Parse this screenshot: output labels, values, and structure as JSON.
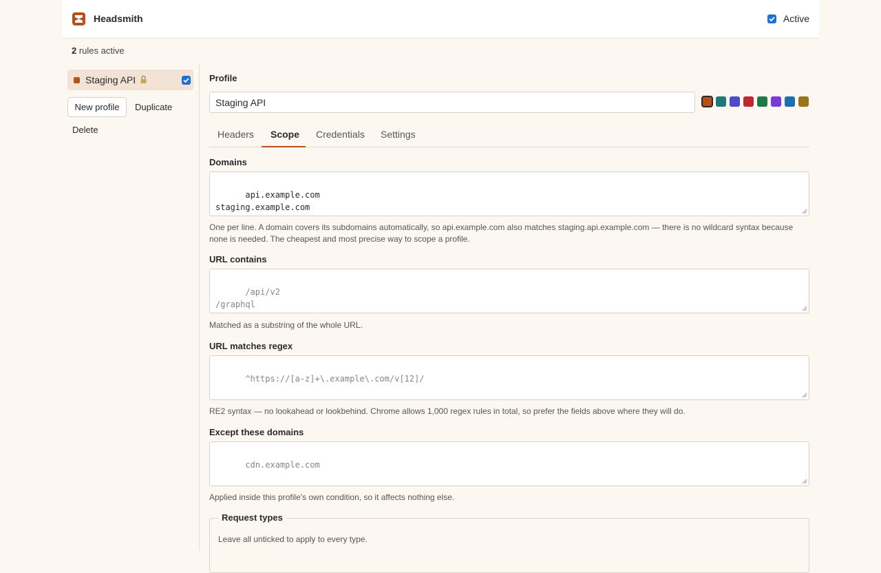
{
  "app": {
    "title": "Headsmith",
    "active_label": "Active",
    "active_checked": true
  },
  "status": {
    "rules_count": "2",
    "rules_suffix": " rules active"
  },
  "sidebar": {
    "profiles": [
      {
        "name": "Staging API",
        "color": "#b8501c",
        "locked": true,
        "enabled": true
      }
    ],
    "new_profile_label": "New profile",
    "duplicate_label": "Duplicate",
    "delete_label": "Delete"
  },
  "profile": {
    "section_label": "Profile",
    "name_value": "Staging API",
    "swatches": [
      "#b8501c",
      "#1e7a76",
      "#4a4cc8",
      "#c0282e",
      "#1c7a4a",
      "#7b3ad6",
      "#1a6fae",
      "#9a7418"
    ],
    "selected_swatch": 0
  },
  "tabs": [
    "Headers",
    "Scope",
    "Credentials",
    "Settings"
  ],
  "active_tab": "Scope",
  "scope": {
    "domains": {
      "label": "Domains",
      "value": "api.example.com\nstaging.example.com",
      "help_line1": "One per line. A domain covers its subdomains automatically, so api.example.com also matches staging.api.example.com — there is no wildcard syntax because",
      "help_line2": "none is needed. The cheapest and most precise way to scope a profile."
    },
    "url_contains": {
      "label": "URL contains",
      "placeholder": "/api/v2\n/graphql",
      "help": "Matched as a substring of the whole URL."
    },
    "url_regex": {
      "label": "URL matches regex",
      "placeholder": "^https://[a-z]+\\.example\\.com/v[12]/",
      "help": "RE2 syntax — no lookahead or lookbehind. Chrome allows 1,000 regex rules in total, so prefer the fields above where they will do."
    },
    "except_domains": {
      "label": "Except these domains",
      "placeholder": "cdn.example.com",
      "help": "Applied inside this profile's own condition, so it affects nothing else."
    },
    "request_types": {
      "legend": "Request types",
      "help": "Leave all unticked to apply to every type."
    }
  }
}
